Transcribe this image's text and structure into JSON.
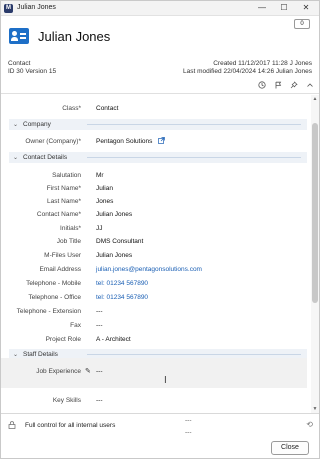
{
  "window": {
    "app_icon": "M",
    "title": "Julian Jones",
    "min": "—",
    "max": "☐",
    "close": "✕"
  },
  "header": {
    "badge_count": "0",
    "title": "Julian Jones",
    "object_type": "Contact",
    "id_version": "ID 30  Version 15",
    "created": "Created 11/12/2017 11:28 J Jones",
    "modified": "Last modified 22/04/2024 14:26 Julian Jones"
  },
  "properties": {
    "class_label": "Class*",
    "class_value": "Contact",
    "section_company": "Company",
    "owner_label": "Owner (Company)*",
    "owner_value": "Pentagon Solutions",
    "section_contact": "Contact Details",
    "salutation_label": "Salutation",
    "salutation_value": "Mr",
    "first_name_label": "First Name*",
    "first_name_value": "Julian",
    "last_name_label": "Last Name*",
    "last_name_value": "Jones",
    "contact_name_label": "Contact Name*",
    "contact_name_value": "Julian Jones",
    "initials_label": "Initials*",
    "initials_value": "JJ",
    "job_title_label": "Job Title",
    "job_title_value": "DMS Consultant",
    "mfiles_user_label": "M-Files User",
    "mfiles_user_value": "Julian Jones",
    "email_label": "Email Address",
    "email_value": "julian.jones@pentagonsolutions.com",
    "mobile_label": "Telephone - Mobile",
    "mobile_value": "tel: 01234 567890",
    "office_label": "Telephone - Office",
    "office_value": "tel: 01234 567890",
    "extension_label": "Telephone - Extension",
    "extension_value": "---",
    "fax_label": "Fax",
    "fax_value": "---",
    "project_role_label": "Project Role",
    "project_role_value": "A - Architect",
    "section_staff": "Staff Details",
    "job_experience_label": "Job Experience",
    "job_experience_value": "---",
    "key_skills_label": "Key Skills",
    "key_skills_value": "---"
  },
  "footer": {
    "permission": "Full control for all internal users",
    "dashes_a": "---",
    "dashes_b": "---",
    "close_label": "Close"
  },
  "colors": {
    "accent": "#1e6fc7",
    "link": "#1a5fb4",
    "section_bg": "#eef2f7"
  },
  "icons": {
    "contact": "contact-card-icon",
    "history": "history-icon",
    "flag": "flag-icon",
    "pin": "pin-icon",
    "collapse": "chevron-up-icon",
    "lock": "lock-icon",
    "sync": "sync-icon",
    "edit": "pencil-icon",
    "external": "external-link-icon"
  }
}
